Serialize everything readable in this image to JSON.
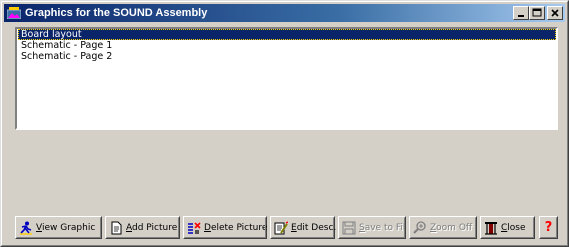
{
  "window": {
    "title": "Graphics for the SOUND Assembly"
  },
  "list": {
    "items": [
      {
        "label": "Board layout",
        "selected": true
      },
      {
        "label": "Schematic - Page 1",
        "selected": false
      },
      {
        "label": "Schematic - Page 2",
        "selected": false
      }
    ]
  },
  "toolbar": {
    "view_graphic": {
      "label": "View Graphic",
      "icon": "running-figure-icon",
      "enabled": true
    },
    "add_picture": {
      "label": "Add Picture",
      "icon": "add-document-icon",
      "enabled": true
    },
    "delete_picture": {
      "label": "Delete Picture",
      "icon": "delete-picture-icon",
      "enabled": true
    },
    "edit_desc": {
      "label": "Edit Desc.",
      "icon": "edit-description-icon",
      "enabled": true
    },
    "save_to_file": {
      "label": "Save to File",
      "icon": "floppy-disk-icon",
      "enabled": false
    },
    "zoom_off": {
      "label": "Zoom Off",
      "icon": "magnifier-icon",
      "enabled": false
    },
    "close": {
      "label": "Close",
      "icon": "door-icon",
      "enabled": true
    },
    "help": {
      "label": "?",
      "icon": "question-mark-icon",
      "enabled": true
    }
  },
  "colors": {
    "titlebar_start": "#0a246a",
    "titlebar_end": "#a6caf0",
    "selection": "#0a246a",
    "face": "#d4d0c8"
  }
}
